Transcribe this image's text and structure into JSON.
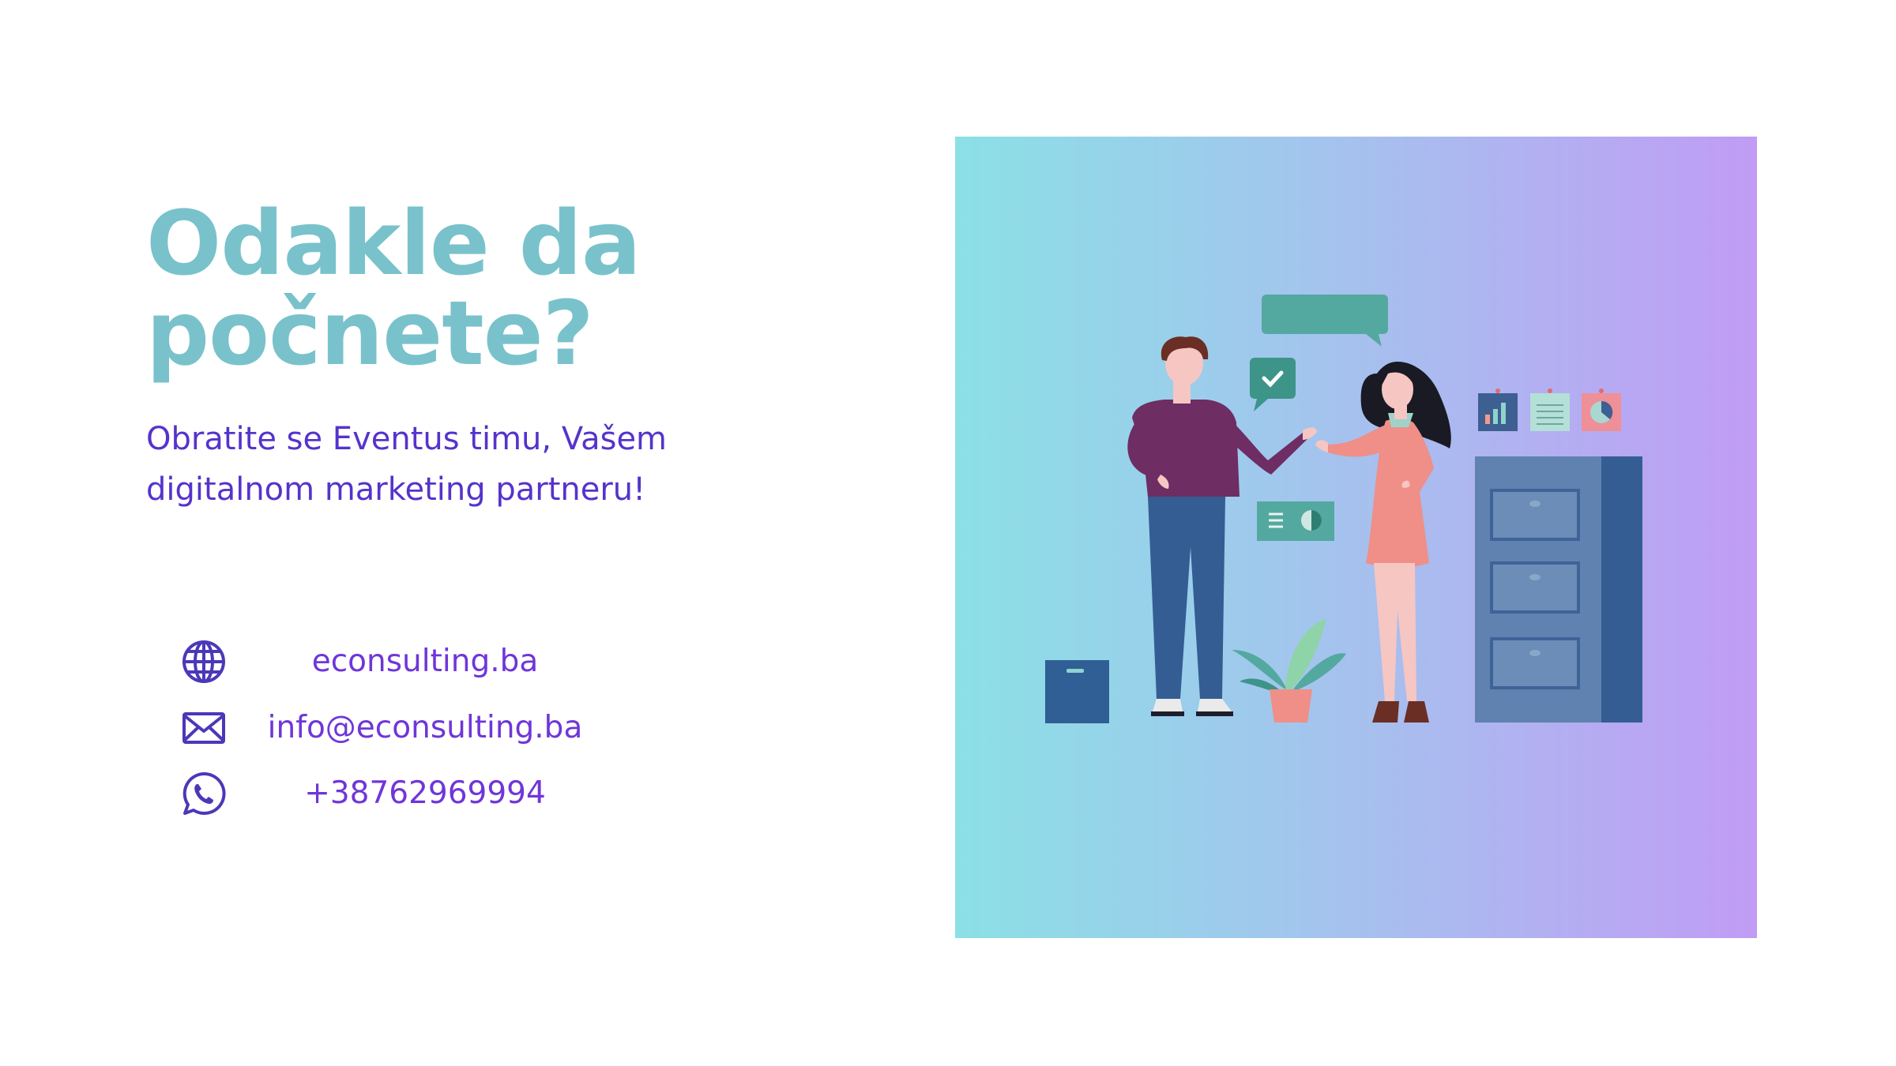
{
  "colors": {
    "title": "#79c2cb",
    "subtitle": "#5533cc",
    "link": "#6f36d9",
    "icon": "#4b38b8"
  },
  "heading": {
    "line1": "Odakle da",
    "line2": "počnete?"
  },
  "subtitle": {
    "line1": "Obratite se Eventus timu, Vašem",
    "line2": "digitalnom marketing partneru!"
  },
  "contacts": [
    {
      "icon": "globe-icon",
      "text": "econsulting.ba"
    },
    {
      "icon": "envelope-icon",
      "text": "info@econsulting.ba"
    },
    {
      "icon": "whatsapp-icon",
      "text": "+38762969994"
    }
  ],
  "illustration": {
    "description_icon": "two-people-office-illustration"
  }
}
